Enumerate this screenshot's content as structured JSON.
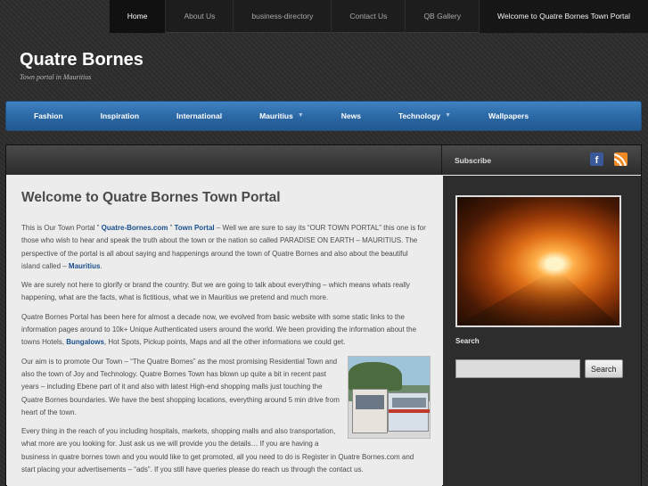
{
  "topnav": {
    "items": [
      {
        "label": "Home"
      },
      {
        "label": "About Us"
      },
      {
        "label": "business-directory"
      },
      {
        "label": "Contact Us"
      },
      {
        "label": "QB Gallery"
      },
      {
        "label": "Welcome to Quatre Bornes Town Portal"
      }
    ]
  },
  "site": {
    "title": "Quatre Bornes",
    "tagline": "Town portal in Mauritius"
  },
  "mainmenu": {
    "items": [
      {
        "label": "Fashion"
      },
      {
        "label": "Inspiration"
      },
      {
        "label": "International"
      },
      {
        "label": "Mauritius"
      },
      {
        "label": "News"
      },
      {
        "label": "Technology"
      },
      {
        "label": "Wallpapers"
      }
    ],
    "arrow": "▼"
  },
  "sidebar": {
    "subscribe": "Subscribe",
    "facebook_glyph": "f",
    "search_label": "Search",
    "search_value": "",
    "search_button": "Search"
  },
  "post": {
    "title": "Welcome to Quatre Bornes Town Portal",
    "p1": {
      "a": "This is Our Town Portal ” ",
      "link1": "Quatre-Bornes.com",
      "b": " ” ",
      "link2": "Town Portal",
      "c": " – Well we are sure to say its “OUR TOWN PORTAL” this one is for those who wish to hear and speak the truth about the town or the nation so called PARADISE ON EARTH – MAURITIUS.  The perspective of the portal is all about saying and happenings around the town of Quatre Bornes and also about the beautiful island called – ",
      "link3": "Mauritius",
      "d": "."
    },
    "p2": "We are surely not here to glorify or brand the country. But we are going to talk about everything – which means whats really happening, what are the facts, what is fictitious, what we in Mauritius we pretend and much more.",
    "p3": {
      "a": "Quatre Bornes Portal has been here for almost a decade now, we evolved from basic website with some static links to the information pages around to 10k+ Unique Authenticated users around the world.  We been providing the information about the towns Hotels, ",
      "link": "Bungalows",
      "b": ", Hot Spots, Pickup points, Maps and all the other informations we could get."
    },
    "p4": "Our aim is to promote Our Town – “The Quatre Bornes” as the most promising Residential Town and also the town of Joy and Technology.  Quatre Bornes Town has blown up quite a bit in recent past years – including Ebene part of it and also with latest High-end shopping malls just touching the Quatre Bornes boundaries.  We have the best shopping locations, everything around 5 min drive from heart of the town.",
    "p5": "Every thing in the reach of you including hospitals, markets, shopping malls and also transportation, what more are you looking for. Just ask us we will provide you the details… If you are having a business in quatre bornes town and you would like to get promoted, all you need to do is Register in Quatre Bornes.com and start placing your advertisements – “ads”.  If you still have queries please do reach us through the contact us."
  }
}
